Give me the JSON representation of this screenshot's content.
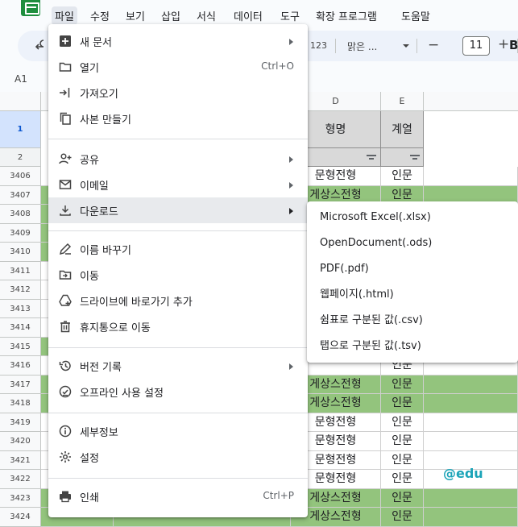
{
  "menubar": {
    "items": [
      "파일",
      "수정",
      "보기",
      "삽입",
      "서식",
      "데이터",
      "도구",
      "확장 프로그램",
      "도움말"
    ]
  },
  "toolbar": {
    "format_123": "123",
    "font": "맑은 ...",
    "font_size": "11",
    "minus": "−",
    "plus": "+",
    "bold": "B"
  },
  "cell_ref": "A1",
  "grid": {
    "col_d": "D",
    "col_e": "E",
    "row1_label": "1",
    "row2_label": "2",
    "header_d": "형명",
    "header_e": "계열",
    "rows": [
      {
        "n": "3406",
        "d": "문형전형",
        "e": "인문",
        "green": false
      },
      {
        "n": "3407",
        "d": "게상스전형",
        "e": "인문",
        "green": true
      },
      {
        "n": "3408",
        "d": "",
        "e": "",
        "green": true
      },
      {
        "n": "3409",
        "d": "",
        "e": "",
        "green": true
      },
      {
        "n": "3410",
        "d": "",
        "e": "",
        "green": true
      },
      {
        "n": "3411",
        "d": "",
        "e": "",
        "green": false
      },
      {
        "n": "3412",
        "d": "",
        "e": "",
        "green": false
      },
      {
        "n": "3413",
        "d": "",
        "e": "",
        "green": false
      },
      {
        "n": "3414",
        "d": "",
        "e": "",
        "green": false
      },
      {
        "n": "3415",
        "d": "",
        "e": "",
        "green": true
      },
      {
        "n": "3416",
        "d": "",
        "e": "인문",
        "green": false
      },
      {
        "n": "3417",
        "d": "게상스전형",
        "e": "인문",
        "green": true
      },
      {
        "n": "3418",
        "d": "게상스전형",
        "e": "인문",
        "green": true
      },
      {
        "n": "3419",
        "d": "문형전형",
        "e": "인문",
        "green": false
      },
      {
        "n": "3420",
        "d": "문형전형",
        "e": "인문",
        "green": false
      },
      {
        "n": "3421",
        "d": "문형전형",
        "e": "인문",
        "green": false
      },
      {
        "n": "3422",
        "d": "문형전형",
        "e": "인문",
        "green": false
      },
      {
        "n": "3423",
        "d": "게상스전형",
        "e": "인문",
        "green": true
      },
      {
        "n": "3424",
        "d": "게상스전형",
        "e": "인문",
        "green": true
      }
    ],
    "watermark": "@edu"
  },
  "file_menu": {
    "items": [
      {
        "label": "새 문서",
        "shortcut": "",
        "submenu": true,
        "icon": "plus-box-icon"
      },
      {
        "label": "열기",
        "shortcut": "Ctrl+O",
        "submenu": false,
        "icon": "folder-icon"
      },
      {
        "label": "가져오기",
        "shortcut": "",
        "submenu": false,
        "icon": "import-arrow-icon"
      },
      {
        "label": "사본 만들기",
        "shortcut": "",
        "submenu": false,
        "icon": "copy-icon"
      },
      {
        "label": "공유",
        "shortcut": "",
        "submenu": true,
        "icon": "person-add-icon"
      },
      {
        "label": "이메일",
        "shortcut": "",
        "submenu": true,
        "icon": "mail-icon"
      },
      {
        "label": "다운로드",
        "shortcut": "",
        "submenu": true,
        "icon": "download-icon"
      },
      {
        "label": "이름 바꾸기",
        "shortcut": "",
        "submenu": false,
        "icon": "rename-icon"
      },
      {
        "label": "이동",
        "shortcut": "",
        "submenu": false,
        "icon": "move-folder-icon"
      },
      {
        "label": "드라이브에 바로가기 추가",
        "shortcut": "",
        "submenu": false,
        "icon": "drive-shortcut-icon"
      },
      {
        "label": "휴지통으로 이동",
        "shortcut": "",
        "submenu": false,
        "icon": "trash-icon"
      },
      {
        "label": "버전 기록",
        "shortcut": "",
        "submenu": true,
        "icon": "history-icon"
      },
      {
        "label": "오프라인 사용 설정",
        "shortcut": "",
        "submenu": false,
        "icon": "offline-icon"
      },
      {
        "label": "세부정보",
        "shortcut": "",
        "submenu": false,
        "icon": "info-icon"
      },
      {
        "label": "설정",
        "shortcut": "",
        "submenu": false,
        "icon": "gear-icon"
      },
      {
        "label": "인쇄",
        "shortcut": "Ctrl+P",
        "submenu": false,
        "icon": "print-icon"
      }
    ]
  },
  "download_menu": {
    "items": [
      "Microsoft Excel(.xlsx)",
      "OpenDocument(.ods)",
      "PDF(.pdf)",
      "웹페이지(.html)",
      "쉼표로 구분된 값(.csv)",
      "탭으로 구분된 값(.tsv)"
    ]
  },
  "colors": {
    "green_fill": "#93c47d",
    "header_fill": "#d9d9d9",
    "highlight": "#e8eaed",
    "brand": "#1e8e3e",
    "watermark": "#1ba4b8"
  }
}
